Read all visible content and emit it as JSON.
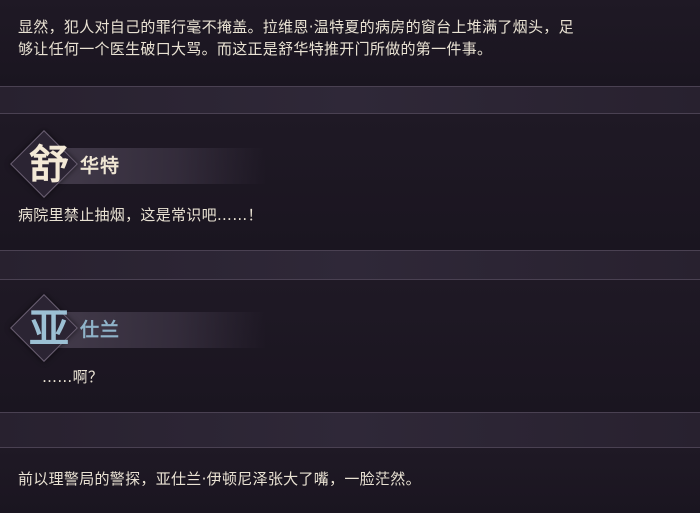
{
  "narration_top": {
    "line1": "显然，犯人对自己的罪行毫不掩盖。拉维恩·温特夏的病房的窗台上堆满了烟头，足",
    "line2": "够让任何一个医生破口大骂。而这正是舒华特推开门所做的第一件事。"
  },
  "speaker1": {
    "initial": "舒",
    "rest": "华特",
    "line": "病院里禁止抽烟，这是常识吧……！",
    "color": "#efe6d4"
  },
  "speaker2": {
    "initial": "亚",
    "rest": "仕兰",
    "line": "……啊？",
    "color": "#8fb3c9"
  },
  "narration_bottom": {
    "line": "前以理警局的警探，亚仕兰·伊顿尼泽张大了嘴，一脸茫然。"
  }
}
